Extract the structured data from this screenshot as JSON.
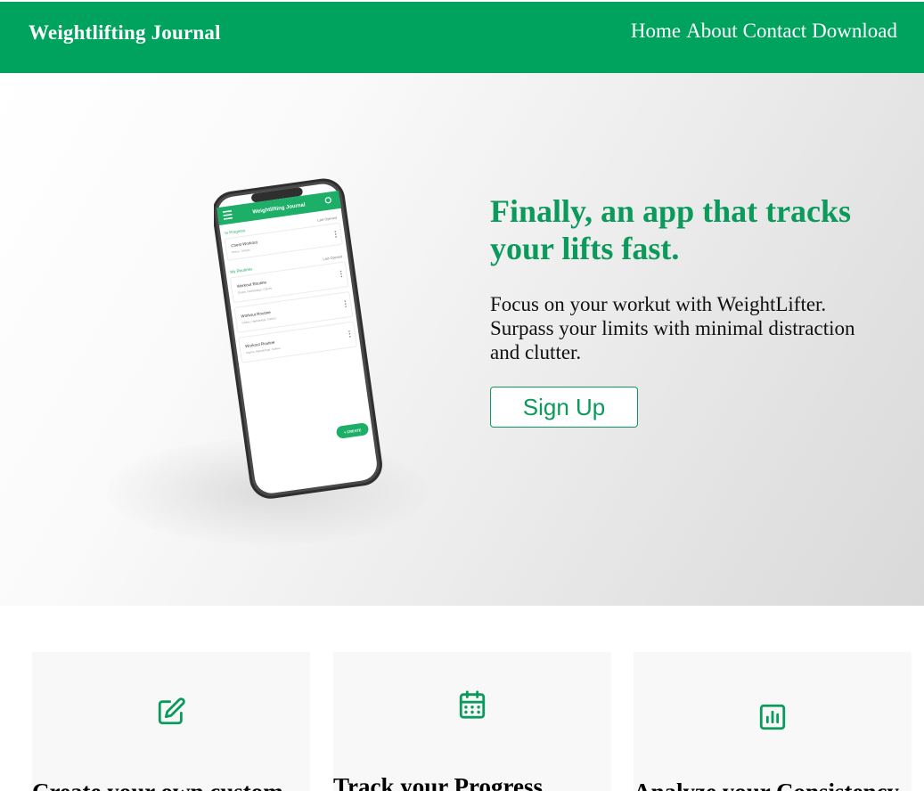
{
  "navbar": {
    "brand": "Weightlifting Journal",
    "links": [
      "Home",
      "About",
      "Contact",
      "Download"
    ],
    "background_color": "#00a35e"
  },
  "hero": {
    "headline": "Finally, an app that tracks your lifts fast.",
    "lead": "Focus on your workut with WeightLifter. Surpass your limits with minimal distraction and clutter.",
    "cta_label": "Sign Up",
    "accent_color": "#0b9a5c",
    "phone_screen": {
      "app_title": "Weightlifting Journal",
      "section_in_progress": "In Progress",
      "sort_in_progress": "Last Opened",
      "in_progress_items": [
        {
          "title": "Chest Workout",
          "subtitle": "Press, Triceps"
        }
      ],
      "section_routines": "My Routines",
      "sort_routines": "Last Opened",
      "routine_items": [
        {
          "title": "Workout Routine",
          "subtitle": "Glutes, Hamstrings, Calves"
        },
        {
          "title": "Workout Routine",
          "subtitle": "Glutes, Hamstrings, Calves"
        },
        {
          "title": "Workout Routine",
          "subtitle": "Glutes, Hamstrings, Calves"
        }
      ],
      "fab_label": "+ CREATE"
    }
  },
  "features": [
    {
      "icon": "edit-square-icon",
      "title": "Create your own custom"
    },
    {
      "icon": "calendar-icon",
      "title": "Track your Progress"
    },
    {
      "icon": "bar-chart-icon",
      "title": "Analyze your Consistency"
    }
  ]
}
